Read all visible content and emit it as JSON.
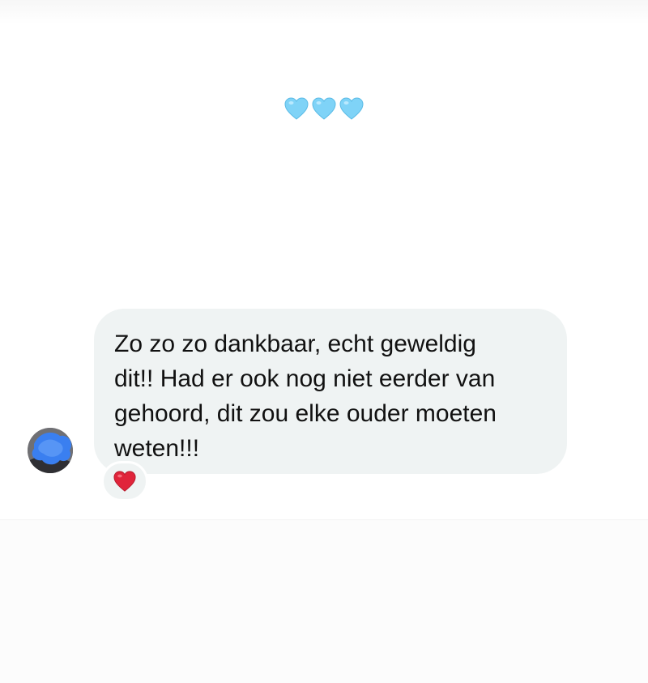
{
  "story_header": {
    "emoji": [
      "blue-heart",
      "blue-heart",
      "blue-heart"
    ],
    "emoji_color": "#7fd3f7"
  },
  "message": {
    "sender_avatar": "blurred-avatar",
    "text": "Zo zo zo dankbaar, echt geweldig\ndit!! Had er ook nog niet eerder van\ngehoord, dit zou elke ouder moeten\nweten!!!",
    "bubble_color": "#eff3f3",
    "reaction": "red-heart",
    "reaction_color": "#e0243a"
  }
}
